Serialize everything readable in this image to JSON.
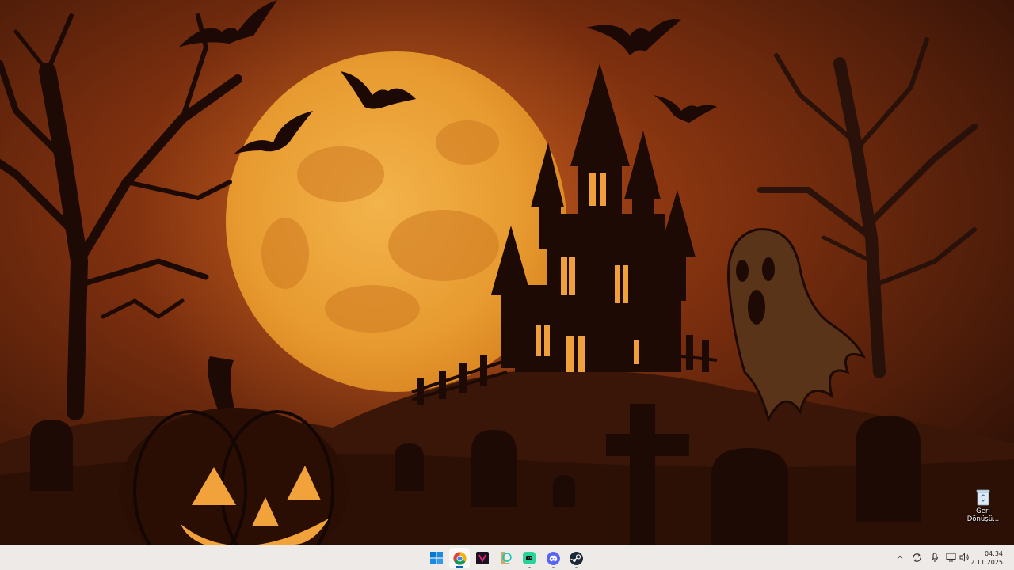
{
  "desktop": {
    "icons": [
      {
        "name": "recycle-bin",
        "label": "Geri Dönüşü..."
      }
    ]
  },
  "taskbar": {
    "apps": [
      {
        "name": "start",
        "icon": "windows-start-icon",
        "active": false
      },
      {
        "name": "chrome",
        "icon": "chrome-icon",
        "active": true
      },
      {
        "name": "app-purple",
        "icon": "app-purple-icon",
        "active": false
      },
      {
        "name": "league-of-legends",
        "icon": "league-icon",
        "active": false
      },
      {
        "name": "chatgpt",
        "icon": "chat-app-icon",
        "active": false
      },
      {
        "name": "discord",
        "icon": "discord-icon",
        "active": false
      },
      {
        "name": "steam",
        "icon": "steam-icon",
        "active": false
      }
    ],
    "tray": {
      "icons": [
        "chevron-up-icon",
        "sync-icon",
        "microphone-icon",
        "network-icon",
        "volume-icon"
      ]
    },
    "clock": {
      "time": "04:34",
      "date": "2.11.2025"
    }
  },
  "colors": {
    "accent": "#0067c0",
    "taskbar_bg": "#eeeae8",
    "moon": "#e8a03a",
    "sky": "#8a3410"
  }
}
